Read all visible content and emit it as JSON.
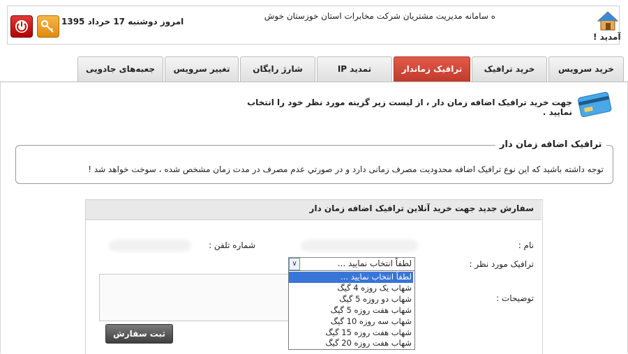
{
  "header": {
    "title": "ه سامانه مدیریت مشتریان شرکت مخابرات استان خوزستان خوش",
    "welcome": "آمدید !",
    "date": "امروز دوشنبه 17 خرداد 1395"
  },
  "tabs": [
    {
      "label": "خرید سرویس"
    },
    {
      "label": "خرید ترافیک"
    },
    {
      "label": "ترافیک زماندار"
    },
    {
      "label": "تمدید IP"
    },
    {
      "label": "شارژ رایگان"
    },
    {
      "label": "تغییر سرویس"
    },
    {
      "label": "جعبه‌های جادویی"
    }
  ],
  "intro": "جهت خرید ترافیک اضافه زمان دار ، از لیست زیر گزینه مورد نظر خود را انتخاب نمایید .",
  "notice": {
    "title": "ترافیک اضافه زمان دار",
    "text": "توجه داشته باشید که این نوع ترافیک اضافه محدودیت مصرف زمانی دارد و در صورتي عدم مصرف در مدت زمان مشخص شده ، سوخت خواهد شد !"
  },
  "form": {
    "title": "سفارش جدید جهت خرید آنلاین ترافیک اضافه زمان دار",
    "name_label": "نام :",
    "phone_label": "شماره تلفن :",
    "traffic_label": "ترافیک مورد نظر :",
    "desc_label": "توضیحات :",
    "select_value": "لطفاً انتخاب نمایید ...",
    "submit_label": "ثبت سفارش",
    "options": [
      "لطفاً انتخاب نمایید ...",
      "شهاب یک روزه 4 گیگ",
      "شهاب دو روزه 5 گیگ",
      "شهاب هفت روزه 5 گیگ",
      "شهاب سه روزه 10 گیگ",
      "شهاب هفت روزه 15 گیگ",
      "شهاب هفت روزه 20 گیگ"
    ]
  },
  "colors": {
    "active_tab": "#c0392b",
    "selected_option": "#3875d7"
  }
}
